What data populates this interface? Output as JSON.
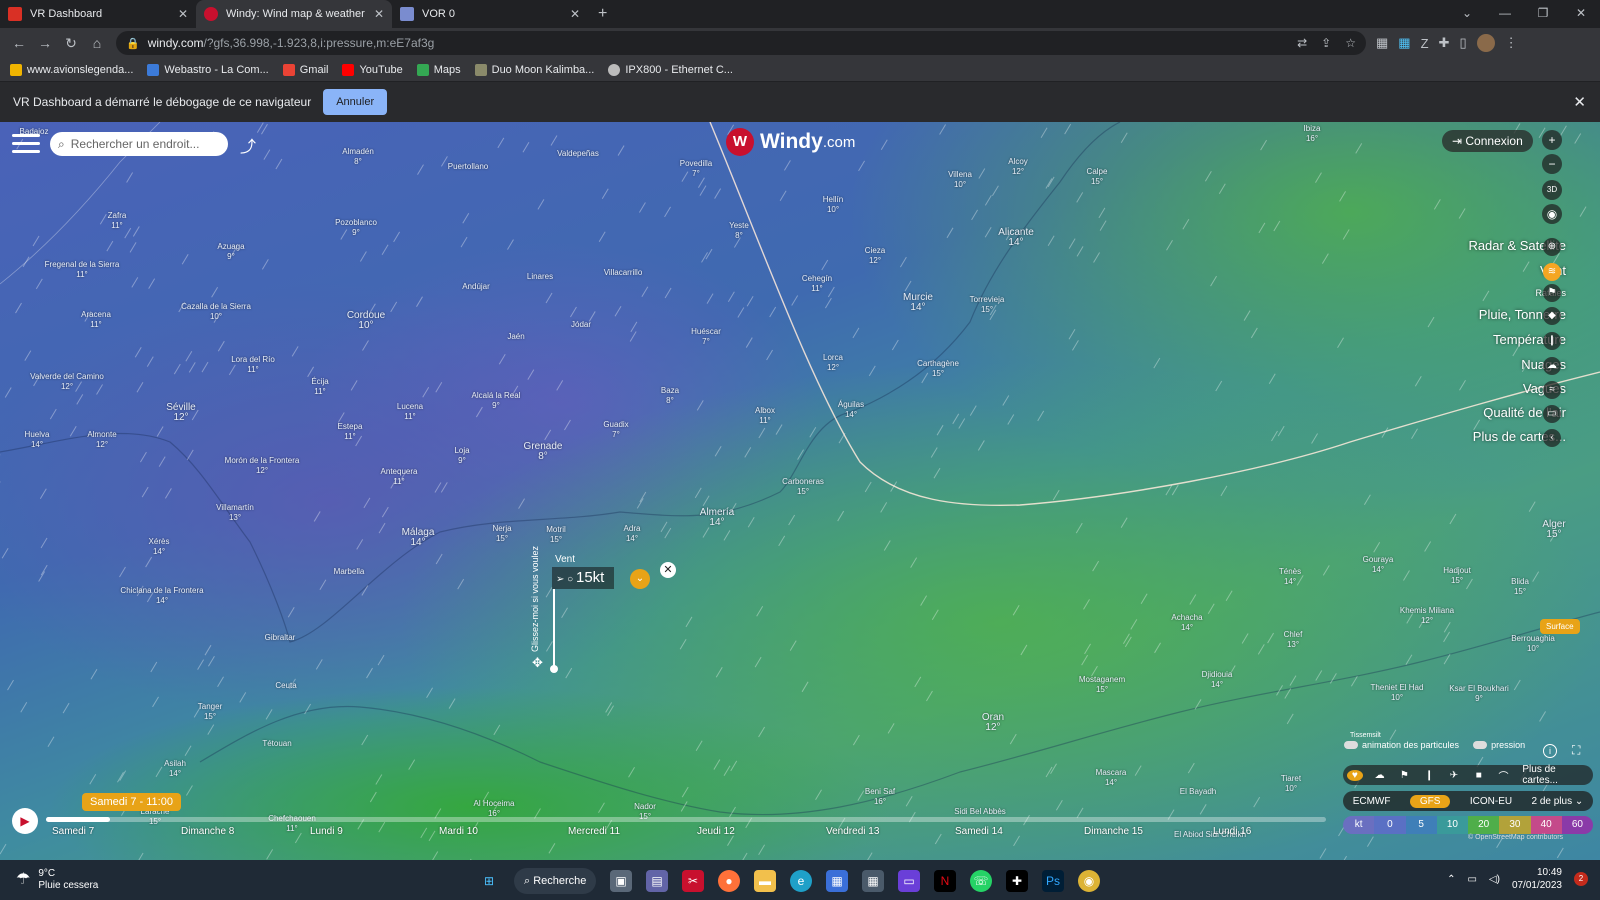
{
  "browser": {
    "tabs": [
      {
        "title": "VR Dashboard",
        "favicon_color": "#d93025"
      },
      {
        "title": "Windy: Wind map & weather forecast",
        "favicon_color": "#c8102e",
        "active": true
      },
      {
        "title": "VOR 0",
        "favicon_color": "#7a8ccf"
      }
    ],
    "new_tab_glyph": "+",
    "url_host": "windy.com",
    "url_rest": "/?gfs,36.998,-1.923,8,i:pressure,m:eE7af3g",
    "bookmarks": [
      {
        "label": "www.avionslegenda...",
        "color": "#f0b400"
      },
      {
        "label": "Webastro - La Com...",
        "color": "#3c7bd9"
      },
      {
        "label": "Gmail",
        "color": "#ea4335"
      },
      {
        "label": "YouTube",
        "color": "#ff0000"
      },
      {
        "label": "Maps",
        "color": "#34a853"
      },
      {
        "label": "Duo Moon Kalimba...",
        "color": "#8a8a6a"
      },
      {
        "label": "IPX800 - Ethernet C...",
        "color": "#bbbbbb"
      }
    ]
  },
  "debug_bar": {
    "message": "VR Dashboard a démarré le débogage de ce navigateur",
    "cancel_label": "Annuler"
  },
  "windy": {
    "search_placeholder": "Rechercher un endroit...",
    "logo_text": "Windy",
    "logo_suffix": ".com",
    "login_label": "Connexion",
    "ctl_3d": "3D",
    "layers": [
      {
        "label": "Radar & Satellite",
        "icon": "satellite-icon",
        "active": false
      },
      {
        "label": "Vent",
        "icon": "wind-icon",
        "active": true
      },
      {
        "label": "Rafales",
        "icon": "gust-flag-icon",
        "active": false,
        "small": true
      },
      {
        "label": "Pluie, Tonnerre",
        "icon": "rain-drop-icon",
        "active": false
      },
      {
        "label": "Température",
        "icon": "thermometer-icon",
        "active": false
      },
      {
        "label": "Nuages",
        "icon": "cloud-icon",
        "active": false
      },
      {
        "label": "Vagues",
        "icon": "waves-icon",
        "active": false
      },
      {
        "label": "Qualité de l'air",
        "icon": "car-icon",
        "active": false
      },
      {
        "label": "Plus de cartes...",
        "icon": "chevron-left-icon",
        "active": false
      }
    ],
    "popup": {
      "title": "Vent",
      "value": "15kt",
      "side_hint": "Glissez-moi si vous voulez"
    },
    "surface_badge": "Surface",
    "tisse_label": "Tissemsilt",
    "toggles": [
      {
        "label": "animation des particules"
      },
      {
        "label": "pression"
      }
    ],
    "quick_more": "Plus de cartes...",
    "models": [
      {
        "label": "ECMWF",
        "active": false
      },
      {
        "label": "GFS",
        "active": true
      },
      {
        "label": "ICON-EU",
        "active": false
      },
      {
        "label": "2 de plus",
        "active": false
      }
    ],
    "scale": [
      {
        "label": "kt",
        "color": "#6a6fc0"
      },
      {
        "label": "0",
        "color": "#5a70c4"
      },
      {
        "label": "5",
        "color": "#3f7fb8"
      },
      {
        "label": "10",
        "color": "#3a9a9a"
      },
      {
        "label": "20",
        "color": "#4fae4a"
      },
      {
        "label": "30",
        "color": "#b2a23a"
      },
      {
        "label": "40",
        "color": "#c44a8a"
      },
      {
        "label": "60",
        "color": "#8a3aa8"
      }
    ],
    "osm_credit": "© OpenStreetMap contributors",
    "timeline": {
      "current": "Samedi 7 - 11:00",
      "progress": 0.05,
      "days": [
        "Samedi 7",
        "Dimanche 8",
        "Lundi 9",
        "Mardi 10",
        "Mercredi 11",
        "Jeudi 12",
        "Vendredi 13",
        "Samedi 14",
        "Dimanche 15",
        "Lundi 16"
      ]
    },
    "places": [
      {
        "name": "Badajoz",
        "temp": ""
      },
      {
        "name": "Almadén",
        "temp": "8°"
      },
      {
        "name": "Puertollano",
        "temp": ""
      },
      {
        "name": "Valdepeñas",
        "temp": ""
      },
      {
        "name": "Povedilla",
        "temp": "7°"
      },
      {
        "name": "Hellín",
        "temp": "10°"
      },
      {
        "name": "Villena",
        "temp": "10°"
      },
      {
        "name": "Alcoy",
        "temp": "12°"
      },
      {
        "name": "Calpe",
        "temp": "15°"
      },
      {
        "name": "Zafra",
        "temp": "11°"
      },
      {
        "name": "Pozoblanco",
        "temp": "9°"
      },
      {
        "name": "Azuaga",
        "temp": "9°"
      },
      {
        "name": "Yeste",
        "temp": "8°"
      },
      {
        "name": "Cieza",
        "temp": "12°"
      },
      {
        "name": "Alicante",
        "temp": "14°"
      },
      {
        "name": "Fregenal de la Sierra",
        "temp": "11°"
      },
      {
        "name": "Linares",
        "temp": ""
      },
      {
        "name": "Villacarrillo",
        "temp": ""
      },
      {
        "name": "Andújar",
        "temp": ""
      },
      {
        "name": "Cehegín",
        "temp": "11°"
      },
      {
        "name": "Aracena",
        "temp": "11°"
      },
      {
        "name": "Cazalla de la Sierra",
        "temp": "10°"
      },
      {
        "name": "Cordoue",
        "temp": "10°"
      },
      {
        "name": "Jódar",
        "temp": ""
      },
      {
        "name": "Murcie",
        "temp": "14°"
      },
      {
        "name": "Torrevieja",
        "temp": "15°"
      },
      {
        "name": "Jaén",
        "temp": ""
      },
      {
        "name": "Huéscar",
        "temp": "7°"
      },
      {
        "name": "Lora del Río",
        "temp": "11°"
      },
      {
        "name": "Lorca",
        "temp": "12°"
      },
      {
        "name": "Carthagène",
        "temp": "15°"
      },
      {
        "name": "Valverde del Camino",
        "temp": "12°"
      },
      {
        "name": "Écija",
        "temp": "11°"
      },
      {
        "name": "Séville",
        "temp": "12°"
      },
      {
        "name": "Lucena",
        "temp": "11°"
      },
      {
        "name": "Alcalá la Real",
        "temp": "9°"
      },
      {
        "name": "Baza",
        "temp": "8°"
      },
      {
        "name": "Águilas",
        "temp": "14°"
      },
      {
        "name": "Albox",
        "temp": "11°"
      },
      {
        "name": "Huelva",
        "temp": "14°"
      },
      {
        "name": "Almonte",
        "temp": "12°"
      },
      {
        "name": "Estepa",
        "temp": "11°"
      },
      {
        "name": "Guadix",
        "temp": "7°"
      },
      {
        "name": "Loja",
        "temp": "9°"
      },
      {
        "name": "Grenade",
        "temp": "8°"
      },
      {
        "name": "Morón de la Frontera",
        "temp": "12°"
      },
      {
        "name": "Antequera",
        "temp": "11°"
      },
      {
        "name": "Carboneras",
        "temp": "15°"
      },
      {
        "name": "Villamartín",
        "temp": "13°"
      },
      {
        "name": "Nerja",
        "temp": "15°"
      },
      {
        "name": "Motril",
        "temp": "15°"
      },
      {
        "name": "Adra",
        "temp": "14°"
      },
      {
        "name": "Almería",
        "temp": "14°"
      },
      {
        "name": "Xérès",
        "temp": "14°"
      },
      {
        "name": "Málaga",
        "temp": "14°"
      },
      {
        "name": "Marbella",
        "temp": ""
      },
      {
        "name": "Chiclana de la Frontera",
        "temp": "14°"
      },
      {
        "name": "Gibraltar",
        "temp": ""
      },
      {
        "name": "Ceuta",
        "temp": ""
      },
      {
        "name": "Tanger",
        "temp": "15°"
      },
      {
        "name": "Tétouan",
        "temp": ""
      },
      {
        "name": "Asilah",
        "temp": "14°"
      },
      {
        "name": "Larache",
        "temp": "15°"
      },
      {
        "name": "Chefchaouen",
        "temp": "11°"
      },
      {
        "name": "Al Hoceima",
        "temp": "16°"
      },
      {
        "name": "Nador",
        "temp": "15°"
      },
      {
        "name": "Beni Saf",
        "temp": "16°"
      },
      {
        "name": "Sidi Bel Abbès",
        "temp": ""
      },
      {
        "name": "Mascara",
        "temp": "14°"
      },
      {
        "name": "El Bayadh",
        "temp": ""
      },
      {
        "name": "Oran",
        "temp": "12°"
      },
      {
        "name": "Mostaganem",
        "temp": "15°"
      },
      {
        "name": "Djidiouia",
        "temp": "14°"
      },
      {
        "name": "Achacha",
        "temp": "14°"
      },
      {
        "name": "Chlef",
        "temp": "13°"
      },
      {
        "name": "Tiaret",
        "temp": "10°"
      },
      {
        "name": "Theniet El Had",
        "temp": "10°"
      },
      {
        "name": "Ksar El Boukhari",
        "temp": "9°"
      },
      {
        "name": "Khemis Miliana",
        "temp": "12°"
      },
      {
        "name": "Berrouaghia",
        "temp": "10°"
      },
      {
        "name": "Ténès",
        "temp": "14°"
      },
      {
        "name": "Gouraya",
        "temp": "14°"
      },
      {
        "name": "Hadjout",
        "temp": "15°"
      },
      {
        "name": "Blida",
        "temp": "15°"
      },
      {
        "name": "Alger",
        "temp": "15°"
      },
      {
        "name": "Ibiza",
        "temp": "16°"
      },
      {
        "name": "El Abiod Sidi Cheikh",
        "temp": ""
      }
    ]
  },
  "taskbar": {
    "weather_temp": "9°C",
    "weather_desc": "Pluie cessera",
    "search_label": "Recherche",
    "time": "10:49",
    "date": "07/01/2023",
    "notif_count": "2",
    "whatsapp_badge": "1",
    "apps": [
      "windows-start-icon",
      "task-view-icon",
      "teams-icon",
      "snip-icon",
      "firefox-icon",
      "explorer-icon",
      "edge-icon",
      "store-icon",
      "calculator-icon",
      "app-icon",
      "netflix-icon",
      "whatsapp-icon",
      "plus-icon",
      "photoshop-icon",
      "chrome-icon"
    ]
  }
}
